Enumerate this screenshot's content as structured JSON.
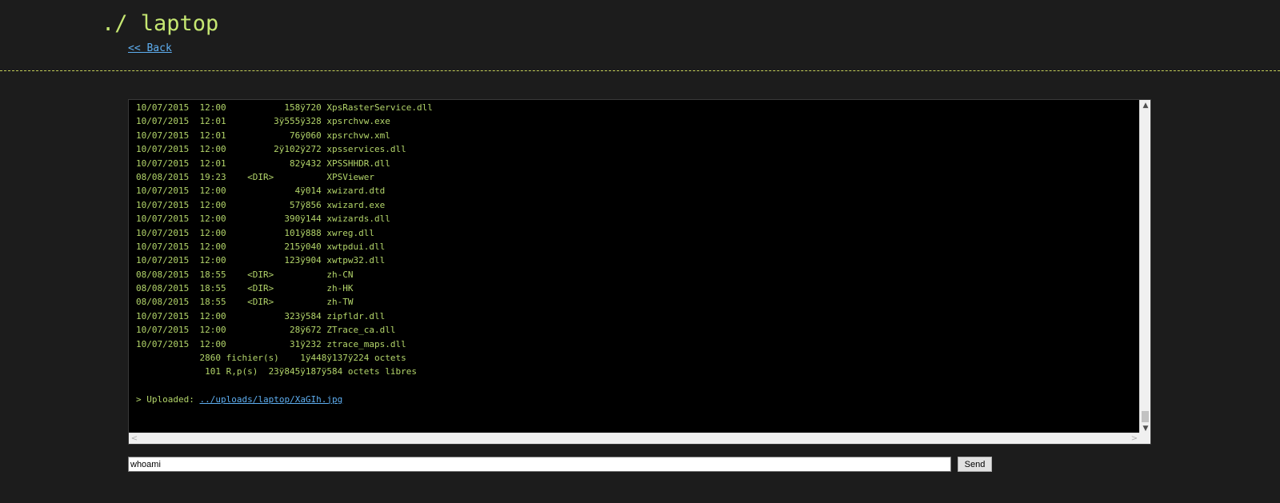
{
  "header": {
    "title": "./ laptop",
    "back_label": "<< Back"
  },
  "console": {
    "lines": [
      "10/07/2015  12:00           158ÿ720 XpsRasterService.dll",
      "10/07/2015  12:01         3ÿ555ÿ328 xpsrchvw.exe",
      "10/07/2015  12:01            76ÿ060 xpsrchvw.xml",
      "10/07/2015  12:00         2ÿ102ÿ272 xpsservices.dll",
      "10/07/2015  12:01            82ÿ432 XPSSHHDR.dll",
      "08/08/2015  19:23    <DIR>          XPSViewer",
      "10/07/2015  12:00             4ÿ014 xwizard.dtd",
      "10/07/2015  12:00            57ÿ856 xwizard.exe",
      "10/07/2015  12:00           390ÿ144 xwizards.dll",
      "10/07/2015  12:00           101ÿ888 xwreg.dll",
      "10/07/2015  12:00           215ÿ040 xwtpdui.dll",
      "10/07/2015  12:00           123ÿ904 xwtpw32.dll",
      "08/08/2015  18:55    <DIR>          zh-CN",
      "08/08/2015  18:55    <DIR>          zh-HK",
      "08/08/2015  18:55    <DIR>          zh-TW",
      "10/07/2015  12:00           323ÿ584 zipfldr.dll",
      "10/07/2015  12:00            28ÿ672 ZTrace_ca.dll",
      "10/07/2015  12:00            31ÿ232 ztrace_maps.dll",
      "            2860 fichier(s)    1ÿ448ÿ137ÿ224 octets",
      "             101 R,p(s)  23ÿ845ÿ187ÿ584 octets libres"
    ],
    "uploaded_prefix": "> Uploaded: ",
    "uploaded_link": "../uploads/laptop/XaGIh.jpg"
  },
  "scrollbar": {
    "up_arrow": "▲",
    "down_arrow": "▼",
    "left_arrow": "<",
    "right_arrow": ">"
  },
  "command": {
    "value": "whoami",
    "send_label": "Send"
  }
}
